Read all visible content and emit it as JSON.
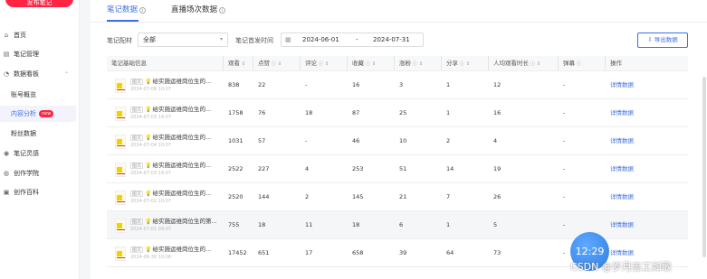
{
  "sidebar": {
    "publish_label": "发布笔记",
    "items": [
      {
        "label": "首页",
        "icon": "home-icon",
        "glyph": "⌂"
      },
      {
        "label": "笔记管理",
        "icon": "document-icon",
        "glyph": "▤"
      },
      {
        "label": "数据看板",
        "icon": "chart-icon",
        "glyph": "◔"
      },
      {
        "label": "笔记灵感",
        "icon": "bulb-icon",
        "glyph": "◉"
      },
      {
        "label": "创作学院",
        "icon": "academy-icon",
        "glyph": "◍"
      },
      {
        "label": "创作百科",
        "icon": "book-icon",
        "glyph": "▣"
      }
    ],
    "sub_items": [
      {
        "label": "账号概览"
      },
      {
        "label": "内容分析",
        "badge": "new"
      },
      {
        "label": "粉丝数据"
      }
    ]
  },
  "tabs": [
    {
      "label": "笔记数据"
    },
    {
      "label": "直播场次数据"
    }
  ],
  "filters": {
    "type_label": "笔记配材",
    "type_value": "全部",
    "date_label": "笔记首发时间",
    "date_start": "2024-06-01",
    "date_sep": "-",
    "date_end": "2024-07-31",
    "export_label": "导出数据"
  },
  "table": {
    "headers": [
      "笔记基础信息",
      "观看",
      "点赞",
      "评论",
      "收藏",
      "涨粉",
      "分享",
      "人均观看时长",
      "弹幕",
      "操作"
    ],
    "rows": [
      {
        "tag": "图文",
        "title": "给实施运维岗位生的...",
        "date": "2024-07-08 10:07",
        "views": "838",
        "likes": "22",
        "comments": "-",
        "collects": "16",
        "fans": "3",
        "shares": "1",
        "avg": "12",
        "danmu": "-",
        "action": "详情数据"
      },
      {
        "tag": "图文",
        "title": "给实施运维岗位生的...",
        "date": "2024-07-03 14:07",
        "views": "1758",
        "likes": "76",
        "comments": "18",
        "collects": "87",
        "fans": "25",
        "shares": "1",
        "avg": "16",
        "danmu": "-",
        "action": "详情数据"
      },
      {
        "tag": "图文",
        "title": "给实施运维岗位生的...",
        "date": "2024-07-04 10:07",
        "views": "1031",
        "likes": "57",
        "comments": "-",
        "collects": "46",
        "fans": "10",
        "shares": "2",
        "avg": "4",
        "danmu": "-",
        "action": "详情数据"
      },
      {
        "tag": "图文",
        "title": "给实施运维岗位生的...",
        "date": "2024-07-03 14:07",
        "views": "2522",
        "likes": "227",
        "comments": "4",
        "collects": "253",
        "fans": "51",
        "shares": "14",
        "avg": "19",
        "danmu": "-",
        "action": "详情数据"
      },
      {
        "tag": "图文",
        "title": "给实施运维岗位生的...",
        "date": "2024-07-02 10:07",
        "views": "2520",
        "likes": "144",
        "comments": "2",
        "collects": "145",
        "fans": "21",
        "shares": "7",
        "avg": "26",
        "danmu": "-",
        "action": "详情数据"
      },
      {
        "tag": "图文",
        "title": "给实施运维岗位生的第...",
        "date": "2024-07-01 09:07",
        "views": "755",
        "likes": "18",
        "comments": "11",
        "collects": "18",
        "fans": "6",
        "shares": "1",
        "avg": "5",
        "danmu": "-",
        "action": "详情数据"
      },
      {
        "tag": "图文",
        "title": "给实施运维岗位生的...",
        "date": "2024-06-30 10:06",
        "views": "17452",
        "likes": "651",
        "comments": "17",
        "collects": "658",
        "fans": "39",
        "shares": "64",
        "avg": "73",
        "danmu": "-",
        "action": "详情数据"
      }
    ]
  },
  "overlay": {
    "clock_text": "12:29",
    "watermark": "CSDN @岁月志工如歌"
  },
  "colors": {
    "accent": "#3b6fe0",
    "brand": "#ff2442"
  }
}
